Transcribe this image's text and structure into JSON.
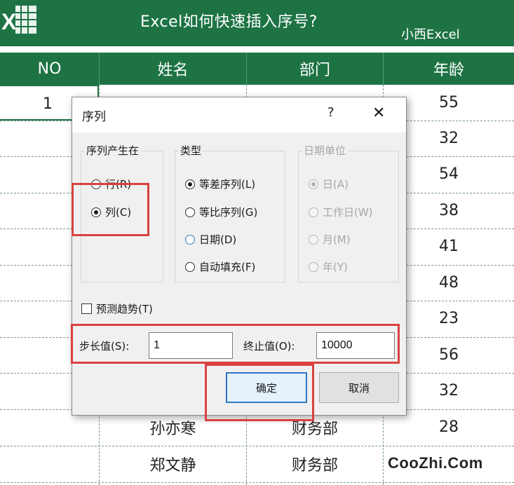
{
  "banner": {
    "title": "Excel如何快速插入序号?",
    "brand": "小西Excel",
    "logo_letter": "X",
    "color": "#1e7344"
  },
  "sheet": {
    "headers": [
      "NO",
      "姓名",
      "部门",
      "年龄"
    ],
    "rows": [
      {
        "no": "1",
        "name": "",
        "dept": "",
        "age": "55"
      },
      {
        "no": "",
        "name": "",
        "dept": "",
        "age": "32"
      },
      {
        "no": "",
        "name": "",
        "dept": "",
        "age": "54"
      },
      {
        "no": "",
        "name": "",
        "dept": "",
        "age": "38"
      },
      {
        "no": "",
        "name": "",
        "dept": "",
        "age": "41"
      },
      {
        "no": "",
        "name": "",
        "dept": "",
        "age": "48"
      },
      {
        "no": "",
        "name": "",
        "dept": "",
        "age": "23"
      },
      {
        "no": "",
        "name": "",
        "dept": "",
        "age": "56"
      },
      {
        "no": "",
        "name": "",
        "dept": "",
        "age": "32"
      },
      {
        "no": "",
        "name": "孙亦寒",
        "dept": "财务部",
        "age": "28"
      },
      {
        "no": "",
        "name": "郑文静",
        "dept": "财务部",
        "age": ""
      }
    ]
  },
  "dialog": {
    "title": "序列",
    "help": "?",
    "close": "✕",
    "series_in": {
      "legend": "序列产生在",
      "options": [
        {
          "label": "行(R)",
          "checked": false
        },
        {
          "label": "列(C)",
          "checked": true
        }
      ]
    },
    "type": {
      "legend": "类型",
      "options": [
        {
          "label": "等差序列(L)",
          "checked": true
        },
        {
          "label": "等比序列(G)",
          "checked": false
        },
        {
          "label": "日期(D)",
          "checked": false
        },
        {
          "label": "自动填充(F)",
          "checked": false
        }
      ]
    },
    "date_unit": {
      "legend": "日期单位",
      "disabled": true,
      "options": [
        {
          "label": "日(A)",
          "checked": true
        },
        {
          "label": "工作日(W)",
          "checked": false
        },
        {
          "label": "月(M)",
          "checked": false
        },
        {
          "label": "年(Y)",
          "checked": false
        }
      ]
    },
    "trend": {
      "label": "预测趋势(T)",
      "checked": false
    },
    "step": {
      "label": "步长值(S):",
      "value": "1"
    },
    "stop": {
      "label": "终止值(O):",
      "value": "10000"
    },
    "ok_label": "确定",
    "cancel_label": "取消"
  },
  "watermark": "CooZhi.Com",
  "colors": {
    "highlight": "#d94141",
    "primary_border": "#2b79c5"
  }
}
